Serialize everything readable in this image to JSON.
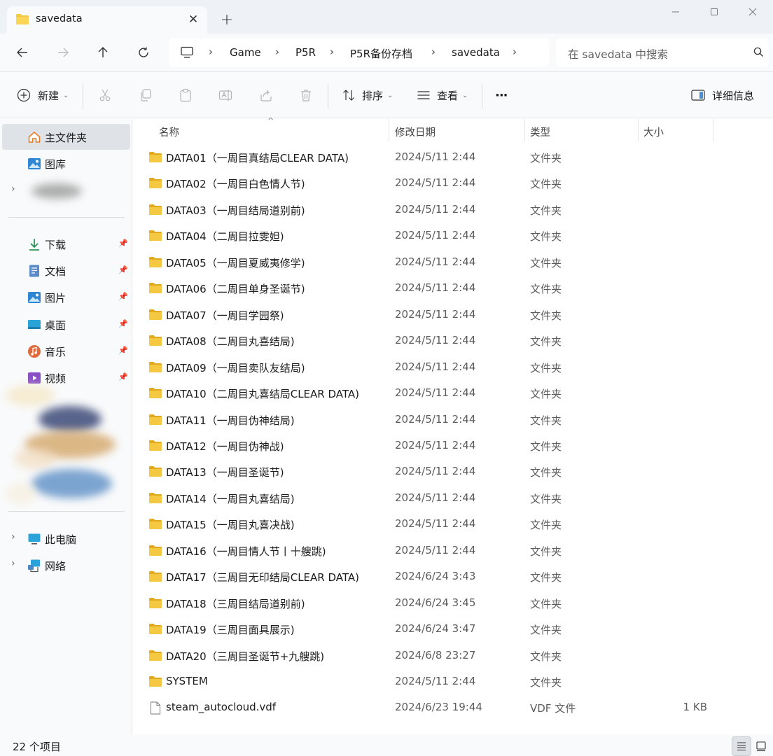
{
  "window": {
    "tab_title": "savedata",
    "tab_close": "✕",
    "new_tab": "+"
  },
  "nav": {
    "breadcrumbs": [
      "Game",
      "P5R",
      "P5R备份存档",
      "savedata"
    ],
    "search_placeholder": "在 savedata 中搜索"
  },
  "commands": {
    "new_label": "新建",
    "sort_label": "排序",
    "view_label": "查看",
    "more_label": "···",
    "details_label": "详细信息"
  },
  "sidebar": {
    "home": "主文件夹",
    "gallery": "图库",
    "quick": [
      {
        "label": "下载"
      },
      {
        "label": "文档"
      },
      {
        "label": "图片"
      },
      {
        "label": "桌面"
      },
      {
        "label": "音乐"
      },
      {
        "label": "视频"
      }
    ],
    "this_pc": "此电脑",
    "network": "网络"
  },
  "columns": {
    "name": "名称",
    "date": "修改日期",
    "type": "类型",
    "size": "大小"
  },
  "files": [
    {
      "name": "DATA01（一周目真结局CLEAR DATA)",
      "date": "2024/5/11 2:44",
      "type": "文件夹",
      "size": "",
      "kind": "folder"
    },
    {
      "name": "DATA02（一周目白色情人节)",
      "date": "2024/5/11 2:44",
      "type": "文件夹",
      "size": "",
      "kind": "folder"
    },
    {
      "name": "DATA03（一周目结局道别前)",
      "date": "2024/5/11 2:44",
      "type": "文件夹",
      "size": "",
      "kind": "folder"
    },
    {
      "name": "DATA04（二周目拉雯妲)",
      "date": "2024/5/11 2:44",
      "type": "文件夹",
      "size": "",
      "kind": "folder"
    },
    {
      "name": "DATA05（一周目夏威夷修学)",
      "date": "2024/5/11 2:44",
      "type": "文件夹",
      "size": "",
      "kind": "folder"
    },
    {
      "name": "DATA06（二周目单身圣诞节)",
      "date": "2024/5/11 2:44",
      "type": "文件夹",
      "size": "",
      "kind": "folder"
    },
    {
      "name": "DATA07（一周目学园祭)",
      "date": "2024/5/11 2:44",
      "type": "文件夹",
      "size": "",
      "kind": "folder"
    },
    {
      "name": "DATA08（二周目丸喜结局)",
      "date": "2024/5/11 2:44",
      "type": "文件夹",
      "size": "",
      "kind": "folder"
    },
    {
      "name": "DATA09（一周目卖队友结局)",
      "date": "2024/5/11 2:44",
      "type": "文件夹",
      "size": "",
      "kind": "folder"
    },
    {
      "name": "DATA10（二周目丸喜结局CLEAR DATA)",
      "date": "2024/5/11 2:44",
      "type": "文件夹",
      "size": "",
      "kind": "folder"
    },
    {
      "name": "DATA11（一周目伪神结局)",
      "date": "2024/5/11 2:44",
      "type": "文件夹",
      "size": "",
      "kind": "folder"
    },
    {
      "name": "DATA12（一周目伪神战)",
      "date": "2024/5/11 2:44",
      "type": "文件夹",
      "size": "",
      "kind": "folder"
    },
    {
      "name": "DATA13（一周目圣诞节)",
      "date": "2024/5/11 2:44",
      "type": "文件夹",
      "size": "",
      "kind": "folder"
    },
    {
      "name": "DATA14（一周目丸喜结局)",
      "date": "2024/5/11 2:44",
      "type": "文件夹",
      "size": "",
      "kind": "folder"
    },
    {
      "name": "DATA15（一周目丸喜决战)",
      "date": "2024/5/11 2:44",
      "type": "文件夹",
      "size": "",
      "kind": "folder"
    },
    {
      "name": "DATA16（一周目情人节丨十艘跳)",
      "date": "2024/5/11 2:44",
      "type": "文件夹",
      "size": "",
      "kind": "folder"
    },
    {
      "name": "DATA17（三周目无印结局CLEAR DATA)",
      "date": "2024/6/24 3:43",
      "type": "文件夹",
      "size": "",
      "kind": "folder"
    },
    {
      "name": "DATA18（三周目结局道别前)",
      "date": "2024/6/24 3:45",
      "type": "文件夹",
      "size": "",
      "kind": "folder"
    },
    {
      "name": "DATA19（三周目面具展示)",
      "date": "2024/6/24 3:47",
      "type": "文件夹",
      "size": "",
      "kind": "folder"
    },
    {
      "name": "DATA20（三周目圣诞节+九艘跳)",
      "date": "2024/6/8 23:27",
      "type": "文件夹",
      "size": "",
      "kind": "folder"
    },
    {
      "name": "SYSTEM",
      "date": "2024/5/11 2:44",
      "type": "文件夹",
      "size": "",
      "kind": "folder"
    },
    {
      "name": "steam_autocloud.vdf",
      "date": "2024/6/23 19:44",
      "type": "VDF 文件",
      "size": "1 KB",
      "kind": "file"
    }
  ],
  "status": {
    "item_count": "22 个项目"
  },
  "colors": {
    "folder": "#f5c842",
    "folder_dark": "#e2a91c",
    "selected_bg": "#dfe2e7",
    "chrome_bg": "#f9fafb",
    "titlebar_bg": "#eef1f6"
  }
}
